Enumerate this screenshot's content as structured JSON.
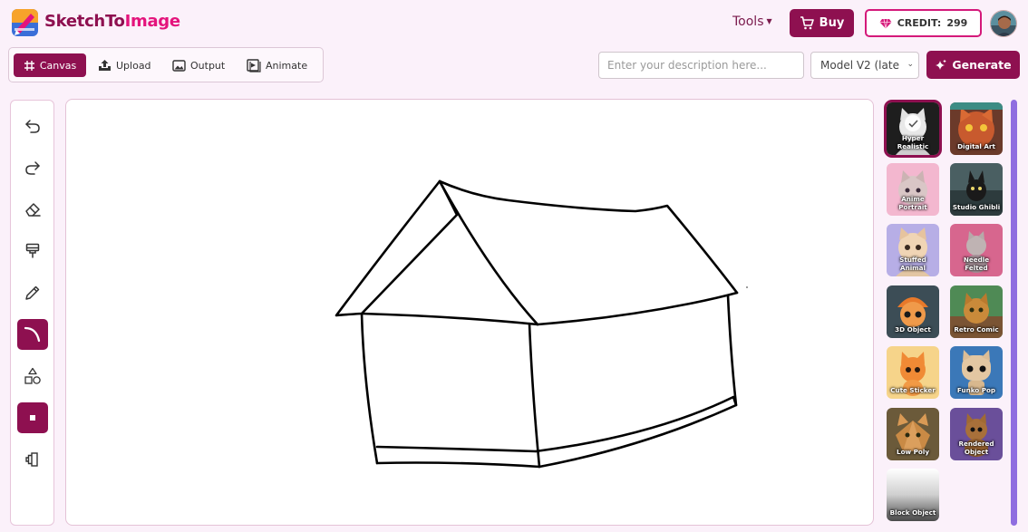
{
  "app": {
    "brand_main": "SketchTo",
    "brand_accent": "Image",
    "brand_color": "#8e1050",
    "brand_accent_color": "#e4147c"
  },
  "header": {
    "tools_label": "Tools",
    "buy_label": "Buy",
    "credit_label": "CREDIT:",
    "credit_value": "299"
  },
  "modes": [
    {
      "label": "Canvas",
      "icon": "grid-icon",
      "active": true
    },
    {
      "label": "Upload",
      "icon": "upload-icon",
      "active": false
    },
    {
      "label": "Output",
      "icon": "image-icon",
      "active": false
    },
    {
      "label": "Animate",
      "icon": "play-icon",
      "active": false
    }
  ],
  "prompt": {
    "placeholder": "Enter your description here...",
    "model_value": "Model V2 (late",
    "generate_label": "Generate"
  },
  "tools": [
    {
      "name": "undo-icon",
      "active": false
    },
    {
      "name": "redo-icon",
      "active": false
    },
    {
      "name": "eraser-icon",
      "active": false
    },
    {
      "name": "paint-brush-icon",
      "active": false
    },
    {
      "name": "pencil-icon",
      "active": false
    },
    {
      "name": "curve-icon",
      "active": true
    },
    {
      "name": "shapes-icon",
      "active": false
    },
    {
      "name": "brush-size-icon",
      "active": true
    },
    {
      "name": "layers-icon",
      "active": false
    }
  ],
  "styles": [
    {
      "label": "Hyper Realistic",
      "selected": true
    },
    {
      "label": "Digital Art",
      "selected": false
    },
    {
      "label": "Anime Portrait",
      "selected": false
    },
    {
      "label": "Studio Ghibli",
      "selected": false
    },
    {
      "label": "Stuffed Animal",
      "selected": false
    },
    {
      "label": "Needle Felted",
      "selected": false
    },
    {
      "label": "3D Object",
      "selected": false
    },
    {
      "label": "Retro Comic",
      "selected": false
    },
    {
      "label": "Cute Sticker",
      "selected": false
    },
    {
      "label": "Funko Pop",
      "selected": false
    },
    {
      "label": "Low Poly",
      "selected": false
    },
    {
      "label": "Rendered Object",
      "selected": false
    },
    {
      "label": "Block Object",
      "selected": false
    }
  ]
}
